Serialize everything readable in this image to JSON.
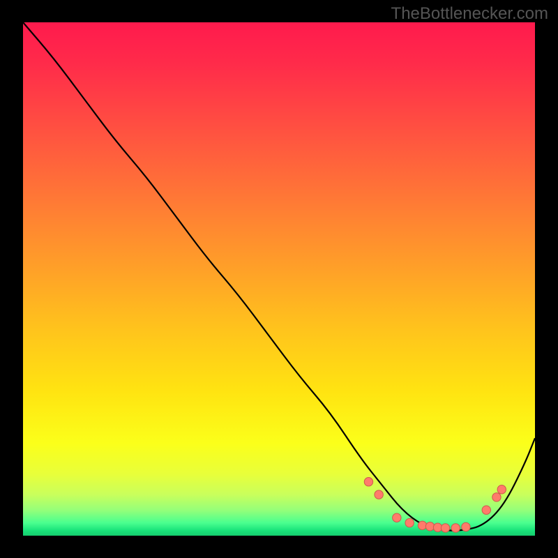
{
  "attribution": "TheBottlenecker.com",
  "chart_data": {
    "type": "line",
    "title": "",
    "xlabel": "",
    "ylabel": "",
    "xlim": [
      0,
      100
    ],
    "ylim": [
      0,
      100
    ],
    "background": "red-green vertical gradient (red top, green bottom)",
    "series": [
      {
        "name": "bottleneck-curve",
        "x": [
          0,
          6,
          12,
          18,
          24,
          30,
          36,
          42,
          48,
          54,
          60,
          66,
          70,
          74,
          78,
          82,
          86,
          90,
          94,
          98,
          100
        ],
        "y": [
          100,
          93,
          85,
          77,
          70,
          62,
          54,
          47,
          39,
          31,
          24,
          15,
          10,
          5,
          2,
          1,
          1,
          2,
          6,
          14,
          19
        ]
      }
    ],
    "markers": [
      {
        "x": 67.5,
        "y": 10.5
      },
      {
        "x": 69.5,
        "y": 8.0
      },
      {
        "x": 73.0,
        "y": 3.5
      },
      {
        "x": 75.5,
        "y": 2.5
      },
      {
        "x": 78.0,
        "y": 2.0
      },
      {
        "x": 79.5,
        "y": 1.8
      },
      {
        "x": 81.0,
        "y": 1.6
      },
      {
        "x": 82.5,
        "y": 1.5
      },
      {
        "x": 84.5,
        "y": 1.5
      },
      {
        "x": 86.5,
        "y": 1.7
      },
      {
        "x": 90.5,
        "y": 5.0
      },
      {
        "x": 92.5,
        "y": 7.5
      },
      {
        "x": 93.5,
        "y": 9.0
      }
    ],
    "annotations": []
  }
}
